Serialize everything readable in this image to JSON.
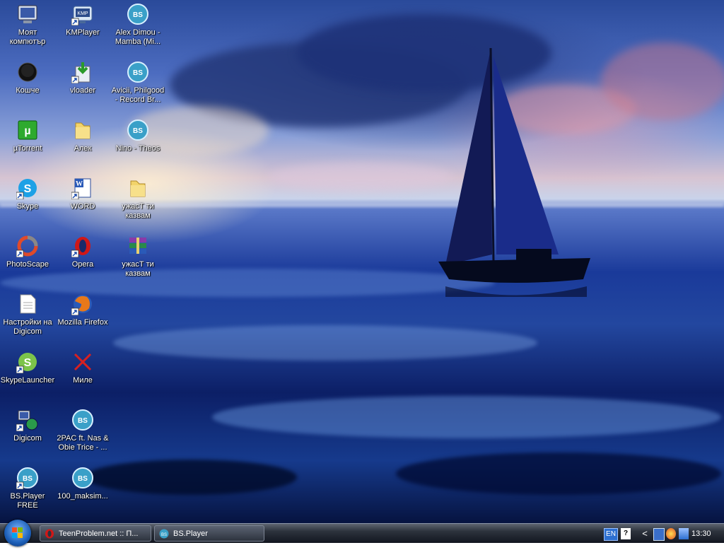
{
  "desktop_icons": [
    {
      "label": "Моят\nкомпютър",
      "icon": "my-computer-icon"
    },
    {
      "label": "KMPlayer",
      "icon": "kmplayer-icon"
    },
    {
      "label": "Alex Dimou -\nMamba (Mi...",
      "icon": "bsplayer-media-icon"
    },
    {
      "label": "Кошче",
      "icon": "recycle-bin-icon"
    },
    {
      "label": "vloader",
      "icon": "vloader-icon"
    },
    {
      "label": "Avicii, Philgood\n- Record Br...",
      "icon": "bsplayer-media-icon"
    },
    {
      "label": "µTorrent",
      "icon": "utorrent-icon"
    },
    {
      "label": "Алек",
      "icon": "folder-icon"
    },
    {
      "label": "Nino - Theos",
      "icon": "bsplayer-media-icon"
    },
    {
      "label": "Skype",
      "icon": "skype-icon"
    },
    {
      "label": "WORD",
      "icon": "word-icon"
    },
    {
      "label": "ужасТ ти\nказвам",
      "icon": "folder-icon"
    },
    {
      "label": "PhotoScape",
      "icon": "photoscape-icon"
    },
    {
      "label": "Opera",
      "icon": "opera-icon"
    },
    {
      "label": "ужасТ ти\nказвам",
      "icon": "winrar-archive-icon"
    },
    {
      "label": "Настройки на\nDigicom",
      "icon": "text-document-icon"
    },
    {
      "label": "Mozilla Firefox",
      "icon": "firefox-icon"
    },
    {
      "label": "SkypeLauncher",
      "icon": "skype-launcher-icon"
    },
    {
      "label": "Миле",
      "icon": "red-x-icon"
    },
    {
      "label": "Digicom",
      "icon": "network-connection-icon"
    },
    {
      "label": "2PAC ft. Nas &\nObie Trice - ...",
      "icon": "bsplayer-media-icon"
    },
    {
      "label": "BS.Player FREE",
      "icon": "bsplayer-icon"
    },
    {
      "label": "100_maksim...",
      "icon": "bsplayer-media-icon"
    }
  ],
  "taskbar": {
    "tasks": [
      {
        "label": "TeenProblem.net :: П...",
        "icon": "opera-icon"
      },
      {
        "label": "BS.Player",
        "icon": "bsplayer-icon"
      }
    ],
    "tray": {
      "language": "EN",
      "help": "?",
      "chevron": "<",
      "clock": "13:30"
    }
  },
  "colors": {
    "label_text": "#ffffff",
    "taskbar_dark": "#121620",
    "opera_red": "#d01818",
    "bs_teal": "#3aa0c8"
  }
}
